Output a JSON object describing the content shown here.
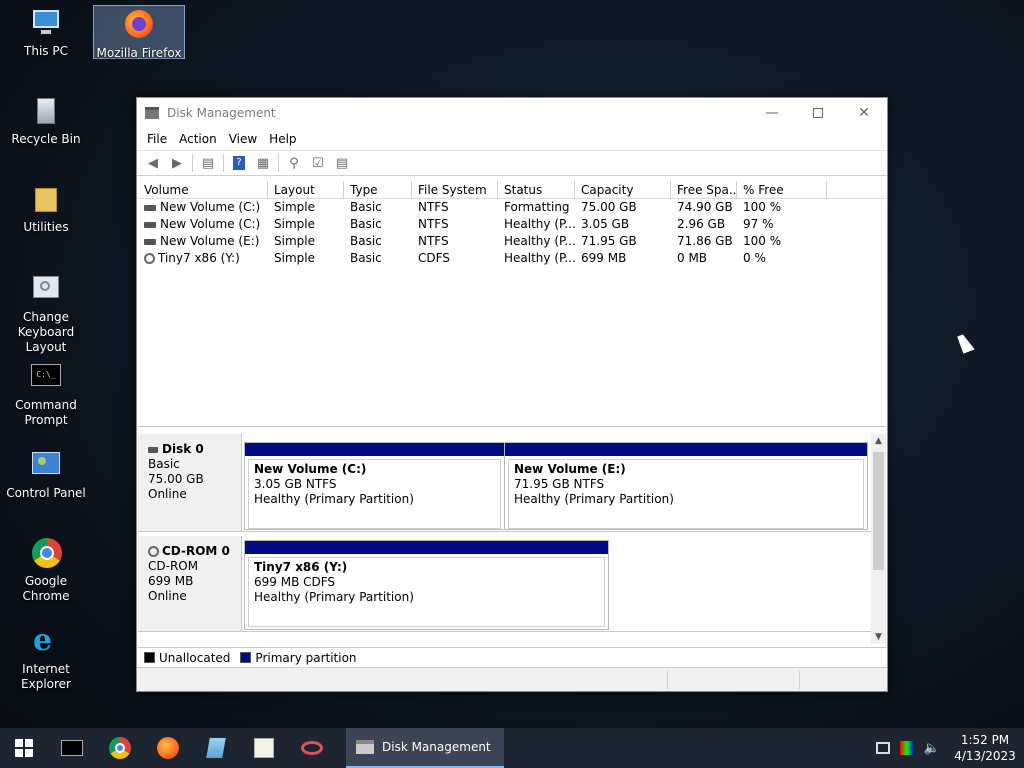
{
  "desktop": {
    "icons": [
      {
        "label": "This PC"
      },
      {
        "label": "Mozilla Firefox"
      },
      {
        "label": "Recycle Bin"
      },
      {
        "label": "Utilities"
      },
      {
        "label": "Change Keyboard Layout"
      },
      {
        "label": "Command Prompt"
      },
      {
        "label": "Control Panel"
      },
      {
        "label": "Google Chrome"
      },
      {
        "label": "Internet Explorer"
      }
    ]
  },
  "window": {
    "title": "Disk Management",
    "menu": [
      "File",
      "Action",
      "View",
      "Help"
    ],
    "list": {
      "columns": [
        "Volume",
        "Layout",
        "Type",
        "File System",
        "Status",
        "Capacity",
        "Free Spa...",
        "% Free"
      ],
      "rows": [
        [
          "New Volume (C:)",
          "Simple",
          "Basic",
          "NTFS",
          "Formatting",
          "75.00 GB",
          "74.90 GB",
          "100 %"
        ],
        [
          "New Volume (C:)",
          "Simple",
          "Basic",
          "NTFS",
          "Healthy (P...",
          "3.05 GB",
          "2.96 GB",
          "97 %"
        ],
        [
          "New Volume (E:)",
          "Simple",
          "Basic",
          "NTFS",
          "Healthy (P...",
          "71.95 GB",
          "71.86 GB",
          "100 %"
        ],
        [
          "Tiny7 x86 (Y:)",
          "Simple",
          "Basic",
          "CDFS",
          "Healthy (P...",
          "699 MB",
          "0 MB",
          "0 %"
        ]
      ]
    },
    "disks": [
      {
        "name": "Disk 0",
        "type": "Basic",
        "size": "75.00 GB",
        "state": "Online",
        "partitions": [
          {
            "name": "New Volume  (C:)",
            "fs": "3.05 GB NTFS",
            "status": "Healthy (Primary Partition)"
          },
          {
            "name": "New Volume  (E:)",
            "fs": "71.95 GB NTFS",
            "status": "Healthy (Primary Partition)"
          }
        ]
      },
      {
        "name": "CD-ROM 0",
        "type": "CD-ROM",
        "size": "699 MB",
        "state": "Online",
        "partitions": [
          {
            "name": "Tiny7 x86  (Y:)",
            "fs": "699 MB CDFS",
            "status": "Healthy (Primary Partition)"
          }
        ]
      }
    ],
    "legend": {
      "unallocated": "Unallocated",
      "primary": "Primary partition"
    },
    "colors": {
      "primary_partition": "#000c84",
      "unallocated": "#000000"
    }
  },
  "taskbar": {
    "active_task": "Disk Management",
    "time": "1:52 PM",
    "date": "4/13/2023"
  }
}
